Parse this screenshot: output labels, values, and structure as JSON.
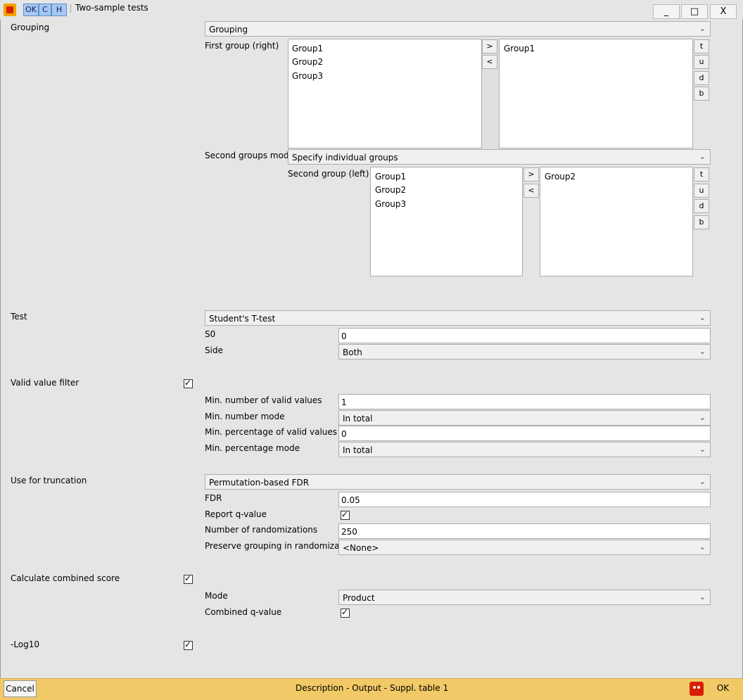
{
  "window": {
    "title": "Two-sample tests",
    "title_buttons": [
      "OK",
      "C",
      "H"
    ],
    "controls": {
      "minimize": "_",
      "maximize": "□",
      "close": "X"
    }
  },
  "grouping": {
    "label": "Grouping",
    "value": "Grouping",
    "first_group_label": "First group (right)",
    "first_available": [
      "Group1",
      "Group2",
      "Group3"
    ],
    "first_selected": [
      "Group1"
    ],
    "second_mode_label": "Second groups mode",
    "second_mode_value": "Specify individual groups",
    "second_group_label": "Second group (left)",
    "second_available": [
      "Group1",
      "Group2",
      "Group3"
    ],
    "second_selected": [
      "Group2"
    ],
    "move_right": ">",
    "move_left": "<",
    "side_buttons": [
      "t",
      "u",
      "d",
      "b"
    ]
  },
  "test": {
    "label": "Test",
    "value": "Student's T-test",
    "s0_label": "S0",
    "s0_value": "0",
    "side_label": "Side",
    "side_value": "Both"
  },
  "valid_filter": {
    "label": "Valid value filter",
    "checked": true,
    "min_number_label": "Min. number of valid values",
    "min_number_value": "1",
    "min_number_mode_label": "Min. number mode",
    "min_number_mode_value": "In total",
    "min_percentage_label": "Min. percentage of valid values",
    "min_percentage_value": "0",
    "min_percentage_mode_label": "Min. percentage mode",
    "min_percentage_mode_value": "In total"
  },
  "truncation": {
    "label": "Use for truncation",
    "value": "Permutation-based FDR",
    "fdr_label": "FDR",
    "fdr_value": "0.05",
    "report_q_label": "Report q-value",
    "report_q_checked": true,
    "randomizations_label": "Number of randomizations",
    "randomizations_value": "250",
    "preserve_label": "Preserve grouping in randomizations",
    "preserve_value": "<None>"
  },
  "combined": {
    "label": "Calculate combined score",
    "checked": true,
    "mode_label": "Mode",
    "mode_value": "Product",
    "combined_q_label": "Combined q-value",
    "combined_q_checked": true
  },
  "log10": {
    "label": "-Log10",
    "checked": true
  },
  "bottom": {
    "cancel": "Cancel",
    "path": "Description - Output - Suppl. table 1",
    "ok": "OK"
  }
}
